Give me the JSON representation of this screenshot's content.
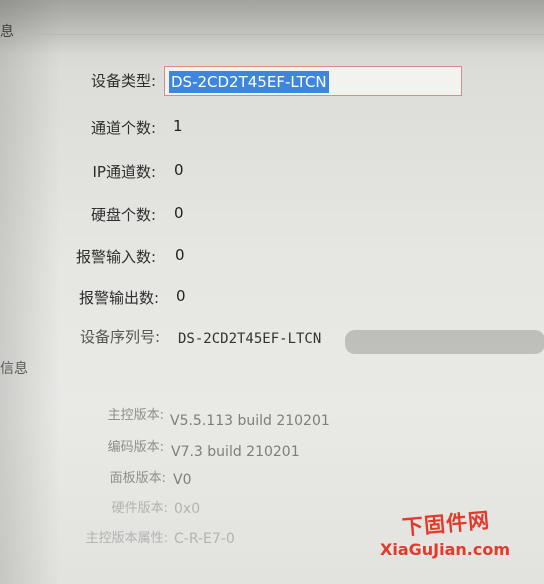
{
  "sections": {
    "top_fragment": "息",
    "mid_fragment": "信息"
  },
  "device": {
    "type_label": "设备类型:",
    "type_value": "DS-2CD2T45EF-LTCN",
    "channels_label": "通道个数:",
    "channels_value": "1",
    "ip_channels_label": "IP通道数:",
    "ip_channels_value": "0",
    "disks_label": "硬盘个数:",
    "disks_value": "0",
    "alarm_in_label": "报警输入数:",
    "alarm_in_value": "0",
    "alarm_out_label": "报警输出数:",
    "alarm_out_value": "0",
    "serial_label": "设备序列号:",
    "serial_value": "DS-2CD2T45EF-LTCN"
  },
  "version": {
    "main_label": "主控版本:",
    "main_value": "V5.5.113 build 210201",
    "encode_label": "编码版本:",
    "encode_value": "V7.3 build 210201",
    "panel_label": "面板版本:",
    "panel_value": "V0",
    "hardware_label": "硬件版本:",
    "hardware_value": "0x0",
    "attr_label": "主控版本属性:",
    "attr_value": "C-R-E7-0"
  },
  "watermark": {
    "cn": "下固件网",
    "en": "XiaGuJian.com"
  },
  "colors": {
    "selection": "#3d86dc",
    "field_border": "#d98a8a",
    "watermark": "#e23a2b"
  }
}
